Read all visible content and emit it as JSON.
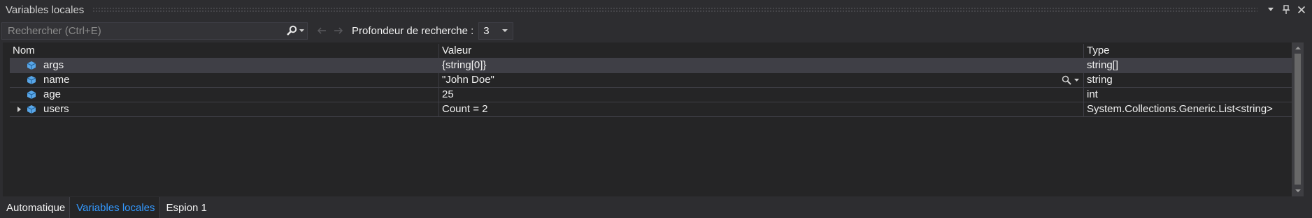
{
  "window": {
    "title": "Variables locales"
  },
  "toolbar": {
    "search_placeholder": "Rechercher (Ctrl+E)",
    "search_value": "",
    "depth_label": "Profondeur de recherche :",
    "depth_value": "3"
  },
  "grid": {
    "columns": [
      "Nom",
      "Valeur",
      "Type"
    ],
    "rows": [
      {
        "name": "args",
        "value": "{string[0]}",
        "type": "string[]",
        "expandable": false,
        "selected": true
      },
      {
        "name": "name",
        "value": "\"John Doe\"",
        "type": "string",
        "expandable": false,
        "selected": false
      },
      {
        "name": "age",
        "value": "25",
        "type": "int",
        "expandable": false,
        "selected": false
      },
      {
        "name": "users",
        "value": "Count = 2",
        "type": "System.Collections.Generic.List<string>",
        "expandable": true,
        "selected": false
      }
    ]
  },
  "tabs": [
    {
      "label": "Automatique",
      "active": false
    },
    {
      "label": "Variables locales",
      "active": true
    },
    {
      "label": "Espion 1",
      "active": false
    }
  ],
  "icons": {
    "dropdown": "triangle-down-icon",
    "pin": "pin-icon",
    "close": "close-icon",
    "search": "search-icon",
    "back": "arrow-left-icon",
    "forward": "arrow-right-icon",
    "variable": "cube-icon",
    "magnifier": "magnifier-icon",
    "expand": "expand-arrow-icon"
  },
  "colors": {
    "background": "#2d2d30",
    "grid_background": "#252526",
    "selected_row": "#3f3f46",
    "active_tab": "#3399ff",
    "variable_icon": "#58a6e8"
  }
}
